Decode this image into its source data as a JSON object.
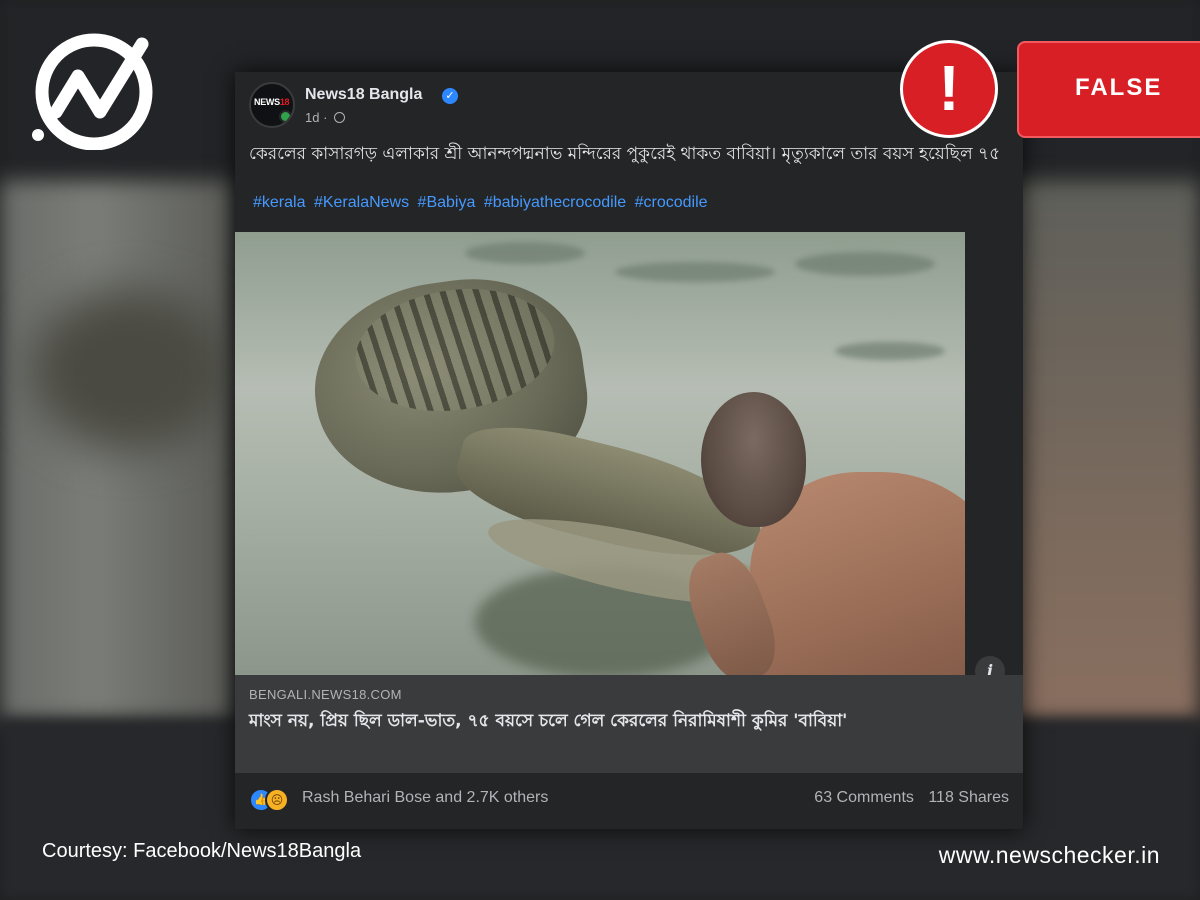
{
  "post": {
    "page_name": "News18 Bangla",
    "avatar_text": {
      "prefix": "NEWS",
      "number": "18"
    },
    "time": "1d",
    "separator": "·",
    "text": "কেরলের কাসারগড় এলাকার শ্রী আনন্দপদ্মনাভ মন্দিরের পুকুরেই থাকত বাবিয়া। মৃত্যুকালে তার বয়স হয়েছিল ৭৫",
    "hashtags": [
      "#kerala",
      "#KeralaNews",
      "#Babiya",
      "#babiyathecrocodile",
      "#crocodile"
    ]
  },
  "link_preview": {
    "domain": "BENGALI.NEWS18.COM",
    "title": "মাংস নয়, প্রিয় ছিল ডাল-ভাত, ৭৫ বয়সে চলে গেল কেরলের নিরামিষাশী কুমির 'বাবিয়া'",
    "info_glyph": "i"
  },
  "reactions": {
    "names": "Rash Behari Bose and 2.7K others",
    "comments": "63 Comments",
    "shares": "118 Shares"
  },
  "overlay": {
    "verdict": "FALSE",
    "alert_glyph": "!",
    "courtesy": "Courtesy: Facebook/News18Bangla",
    "site": "www.newschecker.in"
  },
  "colors": {
    "verdict_red": "#d81f26",
    "hashtag_blue": "#4599ff",
    "card_bg": "#242526"
  },
  "icons": [
    "newschecker-logo-icon",
    "verified-badge-icon",
    "globe-icon",
    "info-icon",
    "like-reaction-icon",
    "sad-reaction-icon",
    "alert-icon"
  ]
}
